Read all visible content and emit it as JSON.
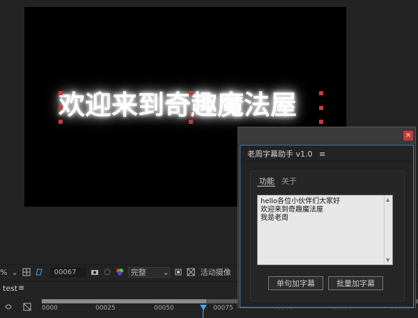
{
  "composition": {
    "title_text": "欢迎来到奇趣魔法屋"
  },
  "viewer_toolbar": {
    "zoom_suffix": "%",
    "timecode": "00067",
    "quality": "完整",
    "camera_label": "活动摄像"
  },
  "timeline": {
    "tab_name": "test",
    "ticks": [
      "0000",
      "00025",
      "00050",
      "00075",
      "00100",
      "00125",
      "00150"
    ]
  },
  "panel": {
    "close_label": "×",
    "title": "老周字幕助手 v1.0",
    "menu_icon": "≡",
    "tabs": [
      "功能",
      "关于"
    ],
    "textarea_lines": [
      "hello各位小伙伴们大家好",
      "欢迎来到奇趣魔法屋",
      "我是老周"
    ],
    "btn_single": "单句加字幕",
    "btn_batch": "批量加字幕"
  }
}
